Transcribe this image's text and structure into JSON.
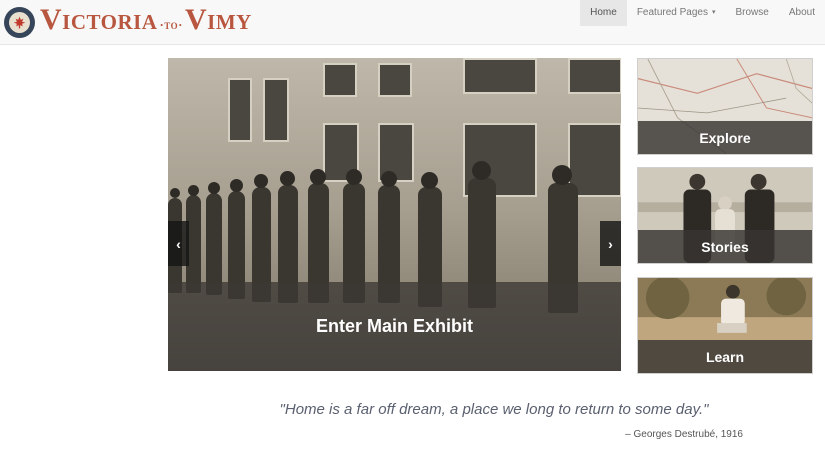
{
  "brand": {
    "part1": "Victoria",
    "sep": "·to·",
    "part2": "Vimy"
  },
  "nav": {
    "items": [
      {
        "label": "Home",
        "active": true
      },
      {
        "label": "Featured Pages",
        "caret": "▾"
      },
      {
        "label": "Browse"
      },
      {
        "label": "About"
      }
    ]
  },
  "hero": {
    "caption": "Enter Main Exhibit",
    "prev_icon": "‹",
    "next_icon": "›"
  },
  "tiles": [
    {
      "label": "Explore"
    },
    {
      "label": "Stories"
    },
    {
      "label": "Learn"
    }
  ],
  "quote": {
    "text": "\"Home is a far off dream, a place we long to return to some day.\"",
    "attribution": "– Georges Destrubé, 1916"
  },
  "colors": {
    "brand": "#b8563f",
    "navbar": "#f8f8f8",
    "emblem": "#37455a"
  }
}
